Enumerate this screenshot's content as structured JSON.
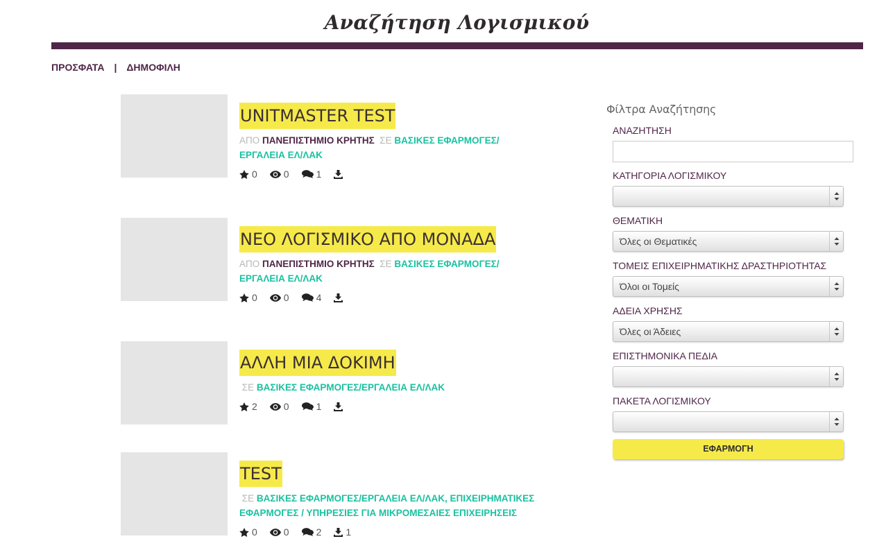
{
  "header": {
    "title": "Αναζήτηση Λογισμικού"
  },
  "tabs": {
    "recent": "ΠΡΟΣΦΑΤΑ",
    "separator": "|",
    "popular": "ΔΗΜΟΦΙΛΗ"
  },
  "items": [
    {
      "title": "UNITMASTER TEST",
      "by_label": "ΑΠΟ",
      "org": "ΠΑΝΕΠΙΣΤΗΜΙΟ ΚΡΗΤΗΣ",
      "in_label": "ΣΕ",
      "category": "ΒΑΣΙΚΕΣ ΕΦΑΡΜΟΓΕΣ/ΕΡΓΑΛΕΙΑ ΕΛ/ΛΑΚ",
      "stars": "0",
      "views": "0",
      "comments": "1",
      "downloads": ""
    },
    {
      "title": "ΝΕΟ ΛΟΓΙΣΜΙΚΟ ΑΠΟ ΜΟΝΑΔΑ",
      "by_label": "ΑΠΟ",
      "org": "ΠΑΝΕΠΙΣΤΗΜΙΟ ΚΡΗΤΗΣ",
      "in_label": "ΣΕ",
      "category": "ΒΑΣΙΚΕΣ ΕΦΑΡΜΟΓΕΣ/ΕΡΓΑΛΕΙΑ ΕΛ/ΛΑΚ",
      "stars": "0",
      "views": "0",
      "comments": "4",
      "downloads": ""
    },
    {
      "title": "ΑΛΛΗ ΜΙΑ ΔΟΚΙΜΗ",
      "in_label": "ΣΕ",
      "category": "ΒΑΣΙΚΕΣ ΕΦΑΡΜΟΓΕΣ/ΕΡΓΑΛΕΙΑ ΕΛ/ΛΑΚ",
      "stars": "2",
      "views": "0",
      "comments": "1",
      "downloads": ""
    },
    {
      "title": "TEST",
      "in_label": "ΣΕ",
      "category": "ΒΑΣΙΚΕΣ ΕΦΑΡΜΟΓΕΣ/ΕΡΓΑΛΕΙΑ ΕΛ/ΛΑΚ, ΕΠΙΧΕΙΡΗΜΑΤΙΚΕΣ ΕΦΑΡΜΟΓΕΣ / ΥΠΗΡΕΣΙΕΣ ΓΙΑ ΜΙΚΡΟΜΕΣΑΙΕΣ ΕΠΙΧΕΙΡΗΣΕΙΣ",
      "stars": "0",
      "views": "0",
      "comments": "2",
      "downloads": "1"
    }
  ],
  "filters": {
    "heading": "Φίλτρα Αναζήτησης",
    "search_label": "ΑΝΑΖΗΤΗΣΗ",
    "search_value": "",
    "category_label": "ΚΑΤΗΓΟΡΙΑ ΛΟΓΙΣΜΙΚΟΥ",
    "category_value": "",
    "theme_label": "ΘΕΜΑΤΙΚΗ",
    "theme_value": "Όλες οι Θεματικές",
    "sector_label": "ΤΟΜΕΙΣ ΕΠΙΧΕΙΡΗΜΑΤΙΚΗΣ ΔΡΑΣΤΗΡΙΟΤΗΤΑΣ",
    "sector_value": "Όλοι οι Τομείς",
    "license_label": "ΑΔΕΙΑ ΧΡΗΣΗΣ",
    "license_value": "Όλες οι Άδειες",
    "science_label": "ΕΠΙΣΤΗΜΟΝΙΚΑ ΠΕΔΙΑ",
    "science_value": "",
    "packages_label": "ΠΑΚΕΤΑ ΛΟΓΙΣΜΙΚΟΥ",
    "packages_value": "",
    "apply_label": "ΕΦΑΡΜΟΓΗ"
  },
  "icons": {
    "star": "star-icon",
    "views": "eye-icon",
    "comments": "comments-icon",
    "downloads": "download-icon"
  }
}
